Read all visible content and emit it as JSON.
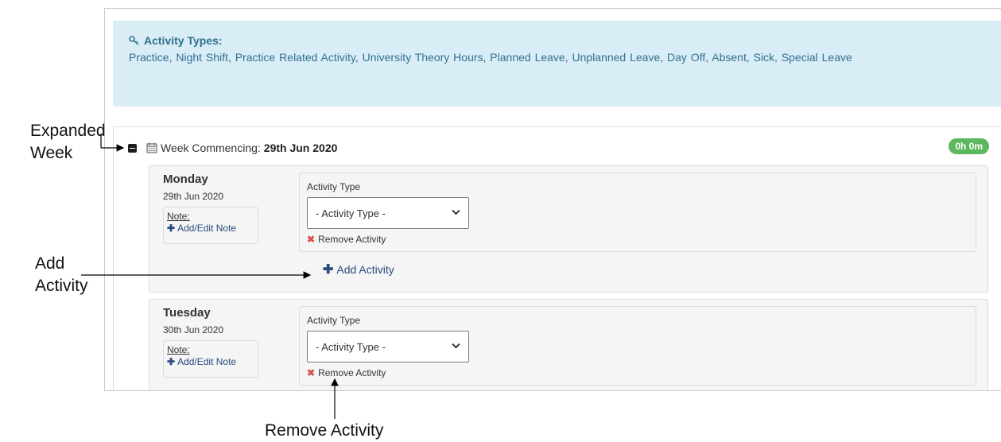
{
  "info": {
    "title": "Activity Types:",
    "text": "Practice,  Night Shift,  Practice Related Activity,  University Theory Hours,  Planned Leave,  Unplanned Leave,  Day Off,  Absent,  Sick,  Special Leave"
  },
  "week": {
    "label": "Week Commencing:",
    "date": "29th Jun 2020",
    "hours": "0h 0m"
  },
  "days": [
    {
      "name": "Monday",
      "date": "29th Jun 2020",
      "note_label": "Note:",
      "note_link": "Add/Edit Note",
      "activity_label": "Activity Type",
      "activity_value": "- Activity Type -",
      "remove": "Remove Activity",
      "add": "Add Activity"
    },
    {
      "name": "Tuesday",
      "date": "30th Jun 2020",
      "note_label": "Note:",
      "note_link": "Add/Edit Note",
      "activity_label": "Activity Type",
      "activity_value": "- Activity Type -",
      "remove": "Remove Activity"
    }
  ],
  "annotations": {
    "expanded_week_line1": "Expanded",
    "expanded_week_line2": "Week",
    "add_activity_line1": "Add",
    "add_activity_line2": "Activity",
    "remove_activity": "Remove Activity"
  },
  "colors": {
    "info_bg": "#d9edf7",
    "info_text": "#31708f",
    "badge": "#5cb85c",
    "link": "#2a4b7c",
    "remove_x": "#d9534f"
  },
  "icons": [
    "key-icon",
    "minus-square-icon",
    "calendar-icon",
    "plus-icon",
    "times-icon",
    "chevron-down-icon"
  ]
}
